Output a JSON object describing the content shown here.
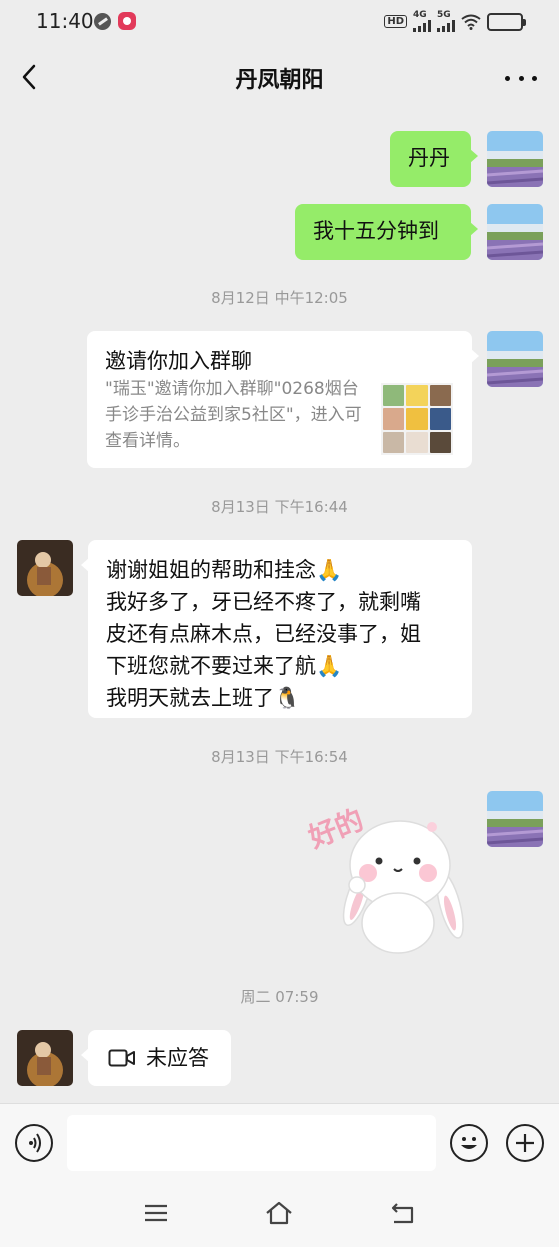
{
  "status_bar": {
    "time": "11:40",
    "hd_label": "HD",
    "net1": "4G",
    "net2": "5G"
  },
  "header": {
    "title": "丹凤朝阳",
    "back_icon": "chevron-left-icon",
    "more_icon": "more-dots-icon"
  },
  "messages": [
    {
      "type": "text",
      "side": "right",
      "text": "丹丹"
    },
    {
      "type": "text",
      "side": "right",
      "text": "我十五分钟到"
    },
    {
      "type": "timestamp",
      "text": "8月12日 中午12:05"
    },
    {
      "type": "invite",
      "side": "right",
      "title": "邀请你加入群聊",
      "desc": "\"瑞玉\"邀请你加入群聊\"0268烟台手诊手治公益到家5社区\"，进入可查看详情。"
    },
    {
      "type": "timestamp",
      "text": "8月13日 下午16:44"
    },
    {
      "type": "text",
      "side": "left",
      "lines": [
        "谢谢姐姐的帮助和挂念🙏",
        "我好多了，牙已经不疼了，就剩嘴",
        "皮还有点麻木点，已经没事了，姐",
        "下班您就不要过来了航🙏",
        "我明天就去上班了🐧"
      ]
    },
    {
      "type": "timestamp",
      "text": "8月13日 下午16:54"
    },
    {
      "type": "sticker",
      "side": "right",
      "caption": "好的"
    },
    {
      "type": "timestamp",
      "text": "周二 07:59"
    },
    {
      "type": "call",
      "side": "left",
      "text": "未应答"
    }
  ],
  "input_bar": {
    "value": "",
    "voice_icon": "voice-icon",
    "emoji_icon": "emoji-icon",
    "plus_icon": "plus-icon"
  },
  "colors": {
    "background": "#ededed",
    "sent_bubble": "#95ec69",
    "received_bubble": "#ffffff",
    "timestamp": "#999999"
  }
}
